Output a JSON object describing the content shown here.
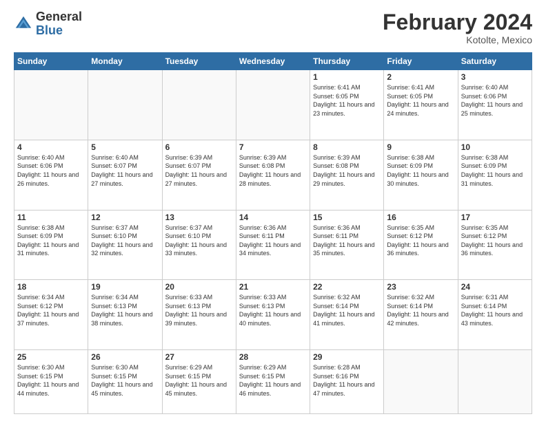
{
  "header": {
    "logo_general": "General",
    "logo_blue": "Blue",
    "month_title": "February 2024",
    "location": "Kotolte, Mexico"
  },
  "weekdays": [
    "Sunday",
    "Monday",
    "Tuesday",
    "Wednesday",
    "Thursday",
    "Friday",
    "Saturday"
  ],
  "weeks": [
    [
      {
        "day": "",
        "info": ""
      },
      {
        "day": "",
        "info": ""
      },
      {
        "day": "",
        "info": ""
      },
      {
        "day": "",
        "info": ""
      },
      {
        "day": "1",
        "info": "Sunrise: 6:41 AM\nSunset: 6:05 PM\nDaylight: 11 hours and 23 minutes."
      },
      {
        "day": "2",
        "info": "Sunrise: 6:41 AM\nSunset: 6:05 PM\nDaylight: 11 hours and 24 minutes."
      },
      {
        "day": "3",
        "info": "Sunrise: 6:40 AM\nSunset: 6:06 PM\nDaylight: 11 hours and 25 minutes."
      }
    ],
    [
      {
        "day": "4",
        "info": "Sunrise: 6:40 AM\nSunset: 6:06 PM\nDaylight: 11 hours and 26 minutes."
      },
      {
        "day": "5",
        "info": "Sunrise: 6:40 AM\nSunset: 6:07 PM\nDaylight: 11 hours and 27 minutes."
      },
      {
        "day": "6",
        "info": "Sunrise: 6:39 AM\nSunset: 6:07 PM\nDaylight: 11 hours and 27 minutes."
      },
      {
        "day": "7",
        "info": "Sunrise: 6:39 AM\nSunset: 6:08 PM\nDaylight: 11 hours and 28 minutes."
      },
      {
        "day": "8",
        "info": "Sunrise: 6:39 AM\nSunset: 6:08 PM\nDaylight: 11 hours and 29 minutes."
      },
      {
        "day": "9",
        "info": "Sunrise: 6:38 AM\nSunset: 6:09 PM\nDaylight: 11 hours and 30 minutes."
      },
      {
        "day": "10",
        "info": "Sunrise: 6:38 AM\nSunset: 6:09 PM\nDaylight: 11 hours and 31 minutes."
      }
    ],
    [
      {
        "day": "11",
        "info": "Sunrise: 6:38 AM\nSunset: 6:09 PM\nDaylight: 11 hours and 31 minutes."
      },
      {
        "day": "12",
        "info": "Sunrise: 6:37 AM\nSunset: 6:10 PM\nDaylight: 11 hours and 32 minutes."
      },
      {
        "day": "13",
        "info": "Sunrise: 6:37 AM\nSunset: 6:10 PM\nDaylight: 11 hours and 33 minutes."
      },
      {
        "day": "14",
        "info": "Sunrise: 6:36 AM\nSunset: 6:11 PM\nDaylight: 11 hours and 34 minutes."
      },
      {
        "day": "15",
        "info": "Sunrise: 6:36 AM\nSunset: 6:11 PM\nDaylight: 11 hours and 35 minutes."
      },
      {
        "day": "16",
        "info": "Sunrise: 6:35 AM\nSunset: 6:12 PM\nDaylight: 11 hours and 36 minutes."
      },
      {
        "day": "17",
        "info": "Sunrise: 6:35 AM\nSunset: 6:12 PM\nDaylight: 11 hours and 36 minutes."
      }
    ],
    [
      {
        "day": "18",
        "info": "Sunrise: 6:34 AM\nSunset: 6:12 PM\nDaylight: 11 hours and 37 minutes."
      },
      {
        "day": "19",
        "info": "Sunrise: 6:34 AM\nSunset: 6:13 PM\nDaylight: 11 hours and 38 minutes."
      },
      {
        "day": "20",
        "info": "Sunrise: 6:33 AM\nSunset: 6:13 PM\nDaylight: 11 hours and 39 minutes."
      },
      {
        "day": "21",
        "info": "Sunrise: 6:33 AM\nSunset: 6:13 PM\nDaylight: 11 hours and 40 minutes."
      },
      {
        "day": "22",
        "info": "Sunrise: 6:32 AM\nSunset: 6:14 PM\nDaylight: 11 hours and 41 minutes."
      },
      {
        "day": "23",
        "info": "Sunrise: 6:32 AM\nSunset: 6:14 PM\nDaylight: 11 hours and 42 minutes."
      },
      {
        "day": "24",
        "info": "Sunrise: 6:31 AM\nSunset: 6:14 PM\nDaylight: 11 hours and 43 minutes."
      }
    ],
    [
      {
        "day": "25",
        "info": "Sunrise: 6:30 AM\nSunset: 6:15 PM\nDaylight: 11 hours and 44 minutes."
      },
      {
        "day": "26",
        "info": "Sunrise: 6:30 AM\nSunset: 6:15 PM\nDaylight: 11 hours and 45 minutes."
      },
      {
        "day": "27",
        "info": "Sunrise: 6:29 AM\nSunset: 6:15 PM\nDaylight: 11 hours and 45 minutes."
      },
      {
        "day": "28",
        "info": "Sunrise: 6:29 AM\nSunset: 6:15 PM\nDaylight: 11 hours and 46 minutes."
      },
      {
        "day": "29",
        "info": "Sunrise: 6:28 AM\nSunset: 6:16 PM\nDaylight: 11 hours and 47 minutes."
      },
      {
        "day": "",
        "info": ""
      },
      {
        "day": "",
        "info": ""
      }
    ]
  ]
}
